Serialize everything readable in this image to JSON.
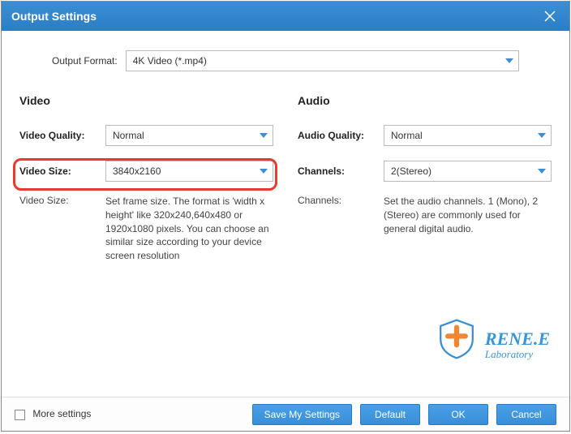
{
  "window": {
    "title": "Output Settings"
  },
  "output": {
    "format_label": "Output Format:",
    "format_value": "4K Video (*.mp4)"
  },
  "video": {
    "title": "Video",
    "quality_label": "Video Quality:",
    "quality_value": "Normal",
    "size_label": "Video Size:",
    "size_value": "3840x2160",
    "desc_label": "Video Size:",
    "desc_text": "Set frame size. The format is 'width x height' like 320x240,640x480 or 1920x1080 pixels. You can choose an similar size according to your device screen resolution"
  },
  "audio": {
    "title": "Audio",
    "quality_label": "Audio Quality:",
    "quality_value": "Normal",
    "channels_label": "Channels:",
    "channels_value": "2(Stereo)",
    "desc_label": "Channels:",
    "desc_text": "Set the audio channels. 1 (Mono), 2 (Stereo) are commonly used for general digital audio."
  },
  "logo": {
    "text1": "RENE.E",
    "text2": "Laboratory"
  },
  "footer": {
    "more_label": "More settings",
    "save_label": "Save My Settings",
    "default_label": "Default",
    "ok_label": "OK",
    "cancel_label": "Cancel"
  }
}
